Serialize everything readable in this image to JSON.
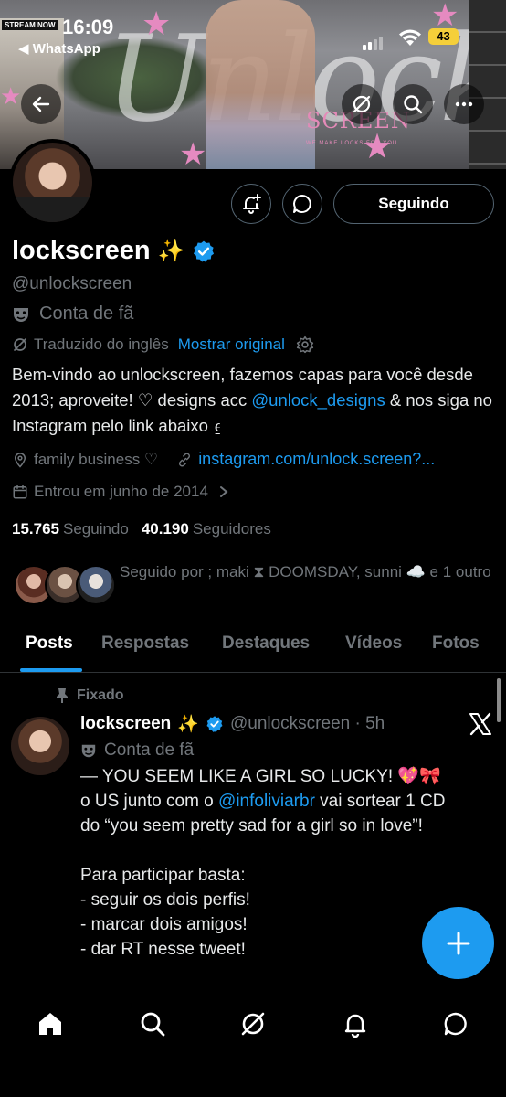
{
  "status_bar": {
    "time": "16:09",
    "back_app": "◀ WhatsApp",
    "stream_badge": "STREAM NOW",
    "battery": "43"
  },
  "banner": {
    "script_text": "Unlock",
    "screen_word": "SCREEN",
    "tagline": "WE MAKE LOCKS FOR YOU"
  },
  "header_actions": {
    "follow_label": "Seguindo"
  },
  "profile": {
    "display_name": "lockscreen",
    "name_emoji": "✨",
    "handle": "@unlockscreen",
    "fan_label": "Conta de fã",
    "translated_label": "Traduzido do inglês",
    "show_original": "Mostrar original",
    "bio_part1": "Bem-vindo ao unlockscreen, fazemos capas para você desde 2013; aproveite! ♡ designs acc ",
    "bio_mention": "@unlock_designs",
    "bio_part2": " & nos siga no Instagram pelo link abaixo ⍷",
    "location": "family business ♡",
    "website": "instagram.com/unlock.screen?...",
    "joined": "Entrou em junho de 2014",
    "following_count": "15.765",
    "following_label": "Seguindo",
    "followers_count": "40.190",
    "followers_label": "Seguidores",
    "followed_by": "Seguido por ; maki ⧗ DOOMSDAY, sunni ☁️ e 1 outro"
  },
  "tabs": [
    {
      "label": "Posts"
    },
    {
      "label": "Respostas"
    },
    {
      "label": "Destaques"
    },
    {
      "label": "Vídeos"
    },
    {
      "label": "Fotos"
    }
  ],
  "post": {
    "pinned_label": "Fixado",
    "author": "lockscreen",
    "author_emoji": "✨",
    "handle_time": "@unlockscreen · 5h",
    "fan_label": "Conta de fã",
    "line1": "— YOU SEEM LIKE A GIRL SO LUCKY! 💖🎀",
    "line2_pre": "o US junto com o ",
    "line2_mention": "@infoliviarbr",
    "line2_post": "  vai sortear 1 CD",
    "line3": "do “you seem pretty sad for a girl so in love”!",
    "line4": "Para participar basta:",
    "line5": "-  seguir os dois perfis!",
    "line6": "- marcar dois amigos!",
    "line7": "- dar RT nesse tweet!"
  },
  "colors": {
    "accent": "#1d9bf0",
    "background": "#000000",
    "muted": "#71767b",
    "battery": "#f5cf3a"
  }
}
